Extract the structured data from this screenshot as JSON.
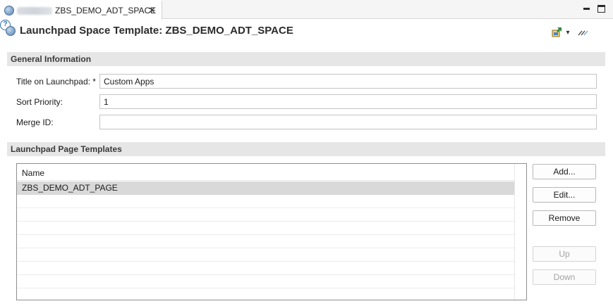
{
  "tab": {
    "label": "ZBS_DEMO_ADT_SPACE",
    "close_glyph": "✕",
    "icon": "space-object-icon"
  },
  "window": {
    "minimize_icon": "minimize-icon",
    "maximize_icon": "maximize-icon"
  },
  "header": {
    "title": "Launchpad Space Template: ZBS_DEMO_ADT_SPACE",
    "icons": [
      "navigate-icon",
      "dropdown-arrow-icon",
      "link-icon",
      "help-icon"
    ],
    "help_glyph": "?",
    "dropdown_glyph": "▾"
  },
  "general": {
    "heading": "General Information",
    "title_label": "Title on Launchpad: *",
    "title_value": "Custom Apps",
    "sort_label": "Sort Priority:",
    "sort_value": "1",
    "merge_label": "Merge ID:",
    "merge_value": ""
  },
  "templates": {
    "heading": "Launchpad Page Templates",
    "column_name": "Name",
    "rows": [
      "ZBS_DEMO_ADT_PAGE"
    ],
    "buttons": {
      "add": "Add...",
      "edit": "Edit...",
      "remove": "Remove",
      "up": "Up",
      "down": "Down"
    }
  },
  "colors": {
    "section_bg": "#e6e6e6",
    "selected_row": "#d9d9d9",
    "help_blue": "#2e6db4"
  }
}
